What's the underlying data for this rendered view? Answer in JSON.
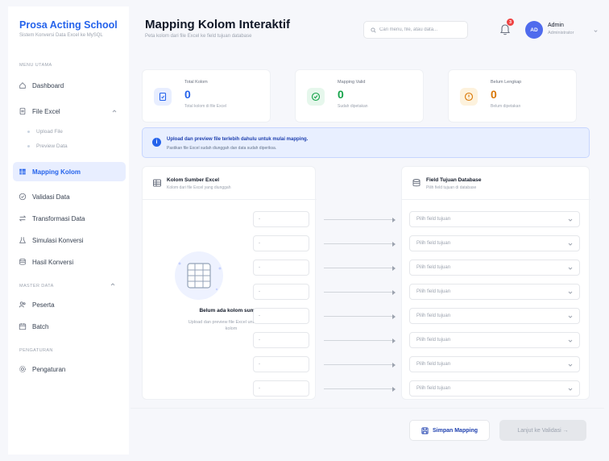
{
  "brand": {
    "title": "Prosa Acting School",
    "subtitle": "Sistem Konversi Data Excel ke MySQL"
  },
  "sidebar": {
    "section_main": "MENU UTAMA",
    "items": [
      {
        "label": "Dashboard",
        "icon": "home-icon"
      },
      {
        "label": "File Excel",
        "icon": "file-icon"
      },
      {
        "label": "Mapping Kolom",
        "icon": "table-icon"
      },
      {
        "label": "Validasi Data",
        "icon": "check-circle-icon"
      },
      {
        "label": "Transformasi Data",
        "icon": "transform-icon"
      },
      {
        "label": "Simulasi Konversi",
        "icon": "flask-icon"
      },
      {
        "label": "Hasil Konversi",
        "icon": "database-icon"
      }
    ],
    "file_sub": [
      "Upload File",
      "Preview Data"
    ],
    "section_master": "MASTER DATA",
    "master_items": [
      {
        "label": "Peserta",
        "icon": "users-icon"
      },
      {
        "label": "Batch",
        "icon": "calendar-icon"
      }
    ],
    "section_settings": "PENGATURAN",
    "settings_items": [
      {
        "label": "Pengaturan",
        "icon": "gear-icon"
      }
    ],
    "active": "Mapping Kolom"
  },
  "header": {
    "title": "Mapping Kolom Interaktif",
    "subtitle": "Peta kolom dari file Excel ke field tujuan database",
    "search_placeholder": "Cari menu, file, atau data...",
    "notif_count": "3",
    "avatar_initials": "AD",
    "user_name": "Admin",
    "user_role": "Administrator"
  },
  "stats": [
    {
      "label": "Total Kolom",
      "value": "0",
      "desc": "Total kolom di file Excel",
      "color": "#2563eb",
      "bg": "#e8eeff",
      "icon": "file-icon"
    },
    {
      "label": "Mapping Valid",
      "value": "0",
      "desc": "Sudah dipetakan",
      "color": "#16a34a",
      "bg": "#e6f7ec",
      "icon": "check-circle-icon"
    },
    {
      "label": "Belum Lengkap",
      "value": "0",
      "desc": "Belum dipetakan",
      "color": "#d97706",
      "bg": "#fdf2dd",
      "icon": "alert-icon"
    }
  ],
  "info": {
    "title": "Upload dan preview file terlebih dahulu untuk mulai mapping.",
    "desc": "Pastikan file Excel sudah diunggah dan data sudah diperiksa."
  },
  "source_panel": {
    "title": "Kolom Sumber Excel",
    "subtitle": "Kolom dari file Excel yang diunggah",
    "empty_title": "Belum ada kolom sumber",
    "empty_desc": "Upload dan preview file Excel untuk melihat kolom"
  },
  "target_panel": {
    "title": "Field Tujuan Database",
    "subtitle": "Pilih field tujuan di database"
  },
  "mapping_rows": [
    {
      "source": "-",
      "target": "Pilih field tujuan"
    },
    {
      "source": "-",
      "target": "Pilih field tujuan"
    },
    {
      "source": "-",
      "target": "Pilih field tujuan"
    },
    {
      "source": "-",
      "target": "Pilih field tujuan"
    },
    {
      "source": "-",
      "target": "Pilih field tujuan"
    },
    {
      "source": "-",
      "target": "Pilih field tujuan"
    },
    {
      "source": "-",
      "target": "Pilih field tujuan"
    },
    {
      "source": "-",
      "target": "Pilih field tujuan"
    }
  ],
  "footer": {
    "save_label": "Simpan Mapping",
    "next_label": "Lanjut ke Validasi →"
  }
}
